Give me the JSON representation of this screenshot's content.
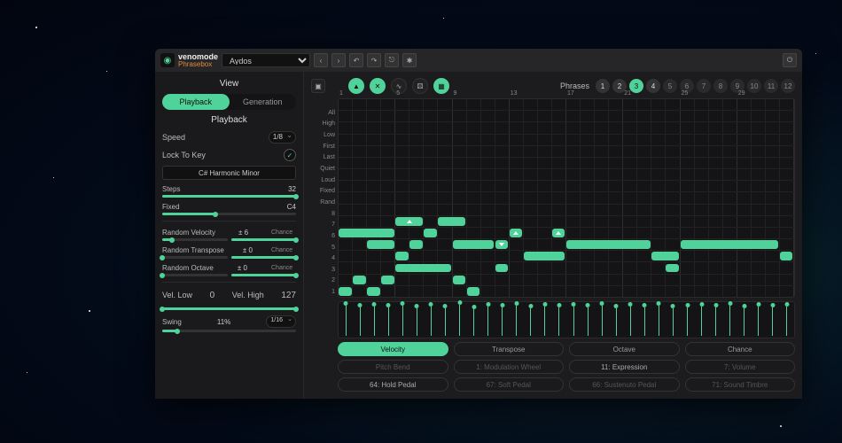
{
  "brand": "venomode",
  "product": "Phrasebox",
  "preset": "Aydos",
  "view": {
    "title": "View",
    "tabs": {
      "playback": "Playback",
      "generation": "Generation"
    },
    "active": "playback"
  },
  "playback": {
    "title": "Playback",
    "speed_label": "Speed",
    "speed_value": "1/8",
    "lock_label": "Lock To Key",
    "lock_checked": "✓",
    "scale": "C# Harmonic Minor",
    "steps_label": "Steps",
    "steps_value": "32",
    "fixed_label": "Fixed",
    "fixed_value": "C4",
    "rand_vel_label": "Random Velocity",
    "rand_vel_value": "± 6",
    "rand_trans_label": "Random Transpose",
    "rand_trans_value": "± 0",
    "rand_oct_label": "Random Octave",
    "rand_oct_value": "± 0",
    "chance_label": "Chance",
    "vel_low_label": "Vel. Low",
    "vel_low_value": "0",
    "vel_high_label": "Vel. High",
    "vel_high_value": "127",
    "swing_label": "Swing",
    "swing_value": "11%",
    "swing_rate": "1/16"
  },
  "phrases": {
    "label": "Phrases",
    "count": 12,
    "active": 3,
    "enabled": [
      1,
      2,
      3,
      4
    ]
  },
  "grid": {
    "col_numbers": [
      "1",
      "",
      "",
      "",
      "5",
      "",
      "",
      "",
      "9",
      "",
      "",
      "",
      "13",
      "",
      "",
      "",
      "17",
      "",
      "",
      "",
      "21",
      "",
      "",
      "",
      "25",
      "",
      "",
      "",
      "29",
      "",
      "",
      ""
    ],
    "row_labels": [
      "All",
      "High",
      "Low",
      "First",
      "Last",
      "Quiet",
      "Loud",
      "Fixed",
      "Rand",
      "8",
      "7",
      "6",
      "5",
      "4",
      "3",
      "2",
      "1"
    ],
    "steps": 32
  },
  "bottom_tabs": {
    "row1": [
      "Velocity",
      "Transpose",
      "Octave",
      "Chance"
    ],
    "row1_active": 0,
    "row2": [
      {
        "t": "Pitch Bend",
        "on": false
      },
      {
        "t": "1: Modulation Wheel",
        "on": false
      },
      {
        "t": "11: Expression",
        "on": true
      },
      {
        "t": "7: Volume",
        "on": false
      }
    ],
    "row3": [
      {
        "t": "64: Hold Pedal",
        "on": true
      },
      {
        "t": "67: Soft Pedal",
        "on": false
      },
      {
        "t": "66: Sustenuto Pedal",
        "on": false
      },
      {
        "t": "71: Sound Timbre",
        "on": false
      }
    ]
  },
  "notes": [
    {
      "row": 10,
      "start": 4,
      "len": 2,
      "tri": "up"
    },
    {
      "row": 10,
      "start": 7,
      "len": 2
    },
    {
      "row": 11,
      "start": 0,
      "len": 4
    },
    {
      "row": 11,
      "start": 6,
      "len": 1
    },
    {
      "row": 11,
      "start": 12,
      "len": 1,
      "tri": "up"
    },
    {
      "row": 11,
      "start": 15,
      "len": 1,
      "tri": "up"
    },
    {
      "row": 12,
      "start": 2,
      "len": 2
    },
    {
      "row": 12,
      "start": 5,
      "len": 1
    },
    {
      "row": 12,
      "start": 8,
      "len": 3
    },
    {
      "row": 12,
      "start": 11,
      "len": 1,
      "tri": "down"
    },
    {
      "row": 12,
      "start": 16,
      "len": 6
    },
    {
      "row": 12,
      "start": 24,
      "len": 7
    },
    {
      "row": 13,
      "start": 4,
      "len": 1
    },
    {
      "row": 13,
      "start": 13,
      "len": 3
    },
    {
      "row": 13,
      "start": 22,
      "len": 2
    },
    {
      "row": 13,
      "start": 31,
      "len": 1
    },
    {
      "row": 14,
      "start": 4,
      "len": 4
    },
    {
      "row": 14,
      "start": 11,
      "len": 1
    },
    {
      "row": 14,
      "start": 23,
      "len": 1
    },
    {
      "row": 15,
      "start": 1,
      "len": 1
    },
    {
      "row": 15,
      "start": 3,
      "len": 1
    },
    {
      "row": 15,
      "start": 8,
      "len": 1
    },
    {
      "row": 16,
      "start": 0,
      "len": 1
    },
    {
      "row": 16,
      "start": 2,
      "len": 1
    },
    {
      "row": 16,
      "start": 9,
      "len": 1
    }
  ],
  "velocity": [
    95,
    90,
    92,
    88,
    94,
    85,
    93,
    87,
    96,
    84,
    91,
    89,
    95,
    86,
    92,
    90,
    93,
    88,
    94,
    85,
    91,
    89,
    95,
    87,
    90,
    92,
    88,
    94,
    86,
    93,
    89,
    91
  ]
}
